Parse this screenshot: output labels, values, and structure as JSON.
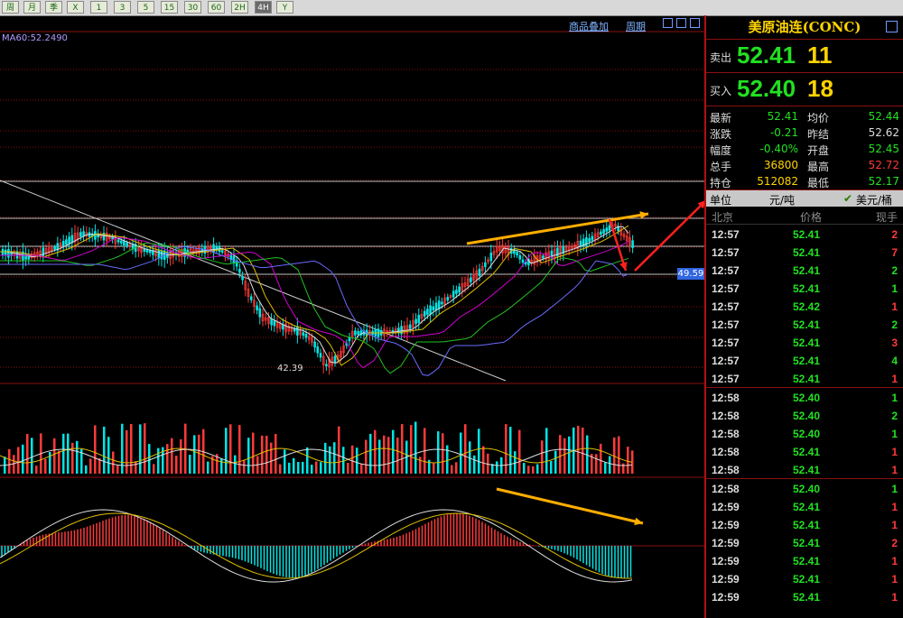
{
  "toolbar": {
    "buttons": [
      "周",
      "月",
      "季",
      "X",
      "1",
      "3",
      "5",
      "15",
      "30",
      "60",
      "2H",
      "4H",
      "Y"
    ],
    "active": "4H"
  },
  "chart_header": {
    "overlay_label": "商品叠加",
    "period_label": "周期",
    "ma_label": "MA60:52.2490"
  },
  "chart_annotations": {
    "right_price_tag": "49.59",
    "low_label": "42.39"
  },
  "colors": {
    "up": "#ff3a3a",
    "down": "#00e5e5",
    "green_text": "#22e022",
    "yellow_text": "#ffd400",
    "grid_red": "#8a1010",
    "arrow_orange": "#ffae00",
    "arrow_red": "#ff2020"
  },
  "quote_panel": {
    "title": "美原油连(CONC)",
    "sell": {
      "label": "卖出",
      "price": "52.41",
      "volume": "11"
    },
    "buy": {
      "label": "买入",
      "price": "52.40",
      "volume": "18"
    },
    "stats": [
      {
        "l1": "最新",
        "v1": "52.41",
        "c1": "#22e022",
        "l2": "均价",
        "v2": "52.44",
        "c2": "#22e022"
      },
      {
        "l1": "涨跌",
        "v1": "-0.21",
        "c1": "#22e022",
        "l2": "昨结",
        "v2": "52.62",
        "c2": "#dddddd"
      },
      {
        "l1": "幅度",
        "v1": "-0.40%",
        "c1": "#22e022",
        "l2": "开盘",
        "v2": "52.45",
        "c2": "#22e022"
      },
      {
        "l1": "总手",
        "v1": "36800",
        "c1": "#ffd400",
        "l2": "最高",
        "v2": "52.72",
        "c2": "#ff3a3a"
      },
      {
        "l1": "持仓",
        "v1": "512082",
        "c1": "#ffd400",
        "l2": "最低",
        "v2": "52.17",
        "c2": "#22e022"
      }
    ],
    "unit_label": "单位",
    "unit_cny": "元/吨",
    "unit_usd": "美元/桶",
    "tick_header": {
      "time": "北京",
      "price": "价格",
      "volume": "现手"
    },
    "ticks": [
      {
        "time": "12:57",
        "price": "52.41",
        "volume": "2",
        "vc": "#ff3a3a"
      },
      {
        "time": "12:57",
        "price": "52.41",
        "volume": "7",
        "vc": "#ff3a3a"
      },
      {
        "time": "12:57",
        "price": "52.41",
        "volume": "2",
        "vc": "#22e022"
      },
      {
        "time": "12:57",
        "price": "52.41",
        "volume": "1",
        "vc": "#22e022"
      },
      {
        "time": "12:57",
        "price": "52.42",
        "volume": "1",
        "vc": "#ff3a3a"
      },
      {
        "time": "12:57",
        "price": "52.41",
        "volume": "2",
        "vc": "#22e022"
      },
      {
        "time": "12:57",
        "price": "52.41",
        "volume": "3",
        "vc": "#ff3a3a"
      },
      {
        "time": "12:57",
        "price": "52.41",
        "volume": "4",
        "vc": "#22e022"
      },
      {
        "time": "12:57",
        "price": "52.41",
        "volume": "1",
        "vc": "#ff3a3a"
      },
      {
        "time": "12:58",
        "price": "52.40",
        "volume": "1",
        "vc": "#22e022"
      },
      {
        "time": "12:58",
        "price": "52.40",
        "volume": "2",
        "vc": "#22e022"
      },
      {
        "time": "12:58",
        "price": "52.40",
        "volume": "1",
        "vc": "#22e022"
      },
      {
        "time": "12:58",
        "price": "52.41",
        "volume": "1",
        "vc": "#ff3a3a"
      },
      {
        "time": "12:58",
        "price": "52.41",
        "volume": "1",
        "vc": "#ff3a3a"
      },
      {
        "time": "12:58",
        "price": "52.40",
        "volume": "1",
        "vc": "#22e022"
      },
      {
        "time": "12:59",
        "price": "52.41",
        "volume": "1",
        "vc": "#ff3a3a"
      },
      {
        "time": "12:59",
        "price": "52.41",
        "volume": "1",
        "vc": "#ff3a3a"
      },
      {
        "time": "12:59",
        "price": "52.41",
        "volume": "2",
        "vc": "#ff3a3a"
      },
      {
        "time": "12:59",
        "price": "52.41",
        "volume": "1",
        "vc": "#ff3a3a"
      },
      {
        "time": "12:59",
        "price": "52.41",
        "volume": "1",
        "vc": "#ff3a3a"
      },
      {
        "time": "12:59",
        "price": "52.41",
        "volume": "1",
        "vc": "#ff3a3a"
      }
    ]
  }
}
